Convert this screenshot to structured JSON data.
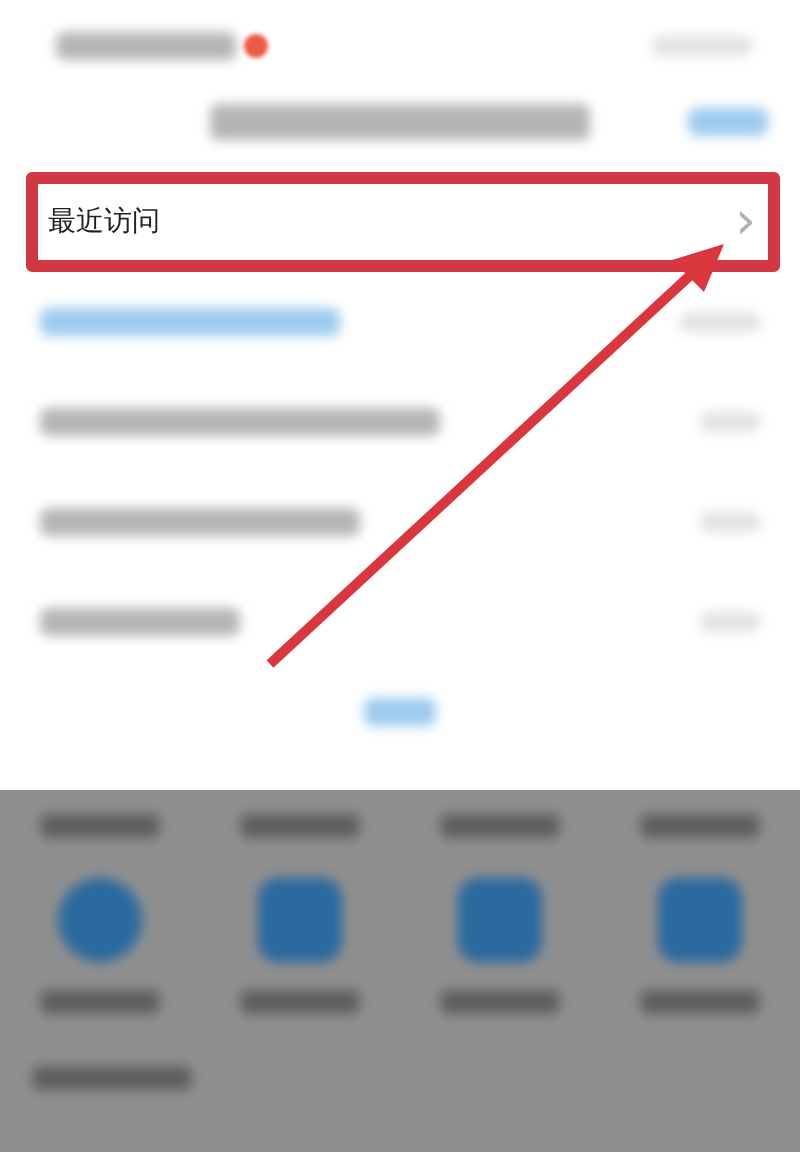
{
  "recent_row": {
    "label": "最近访问",
    "chevron": "›",
    "highlighted": true
  }
}
